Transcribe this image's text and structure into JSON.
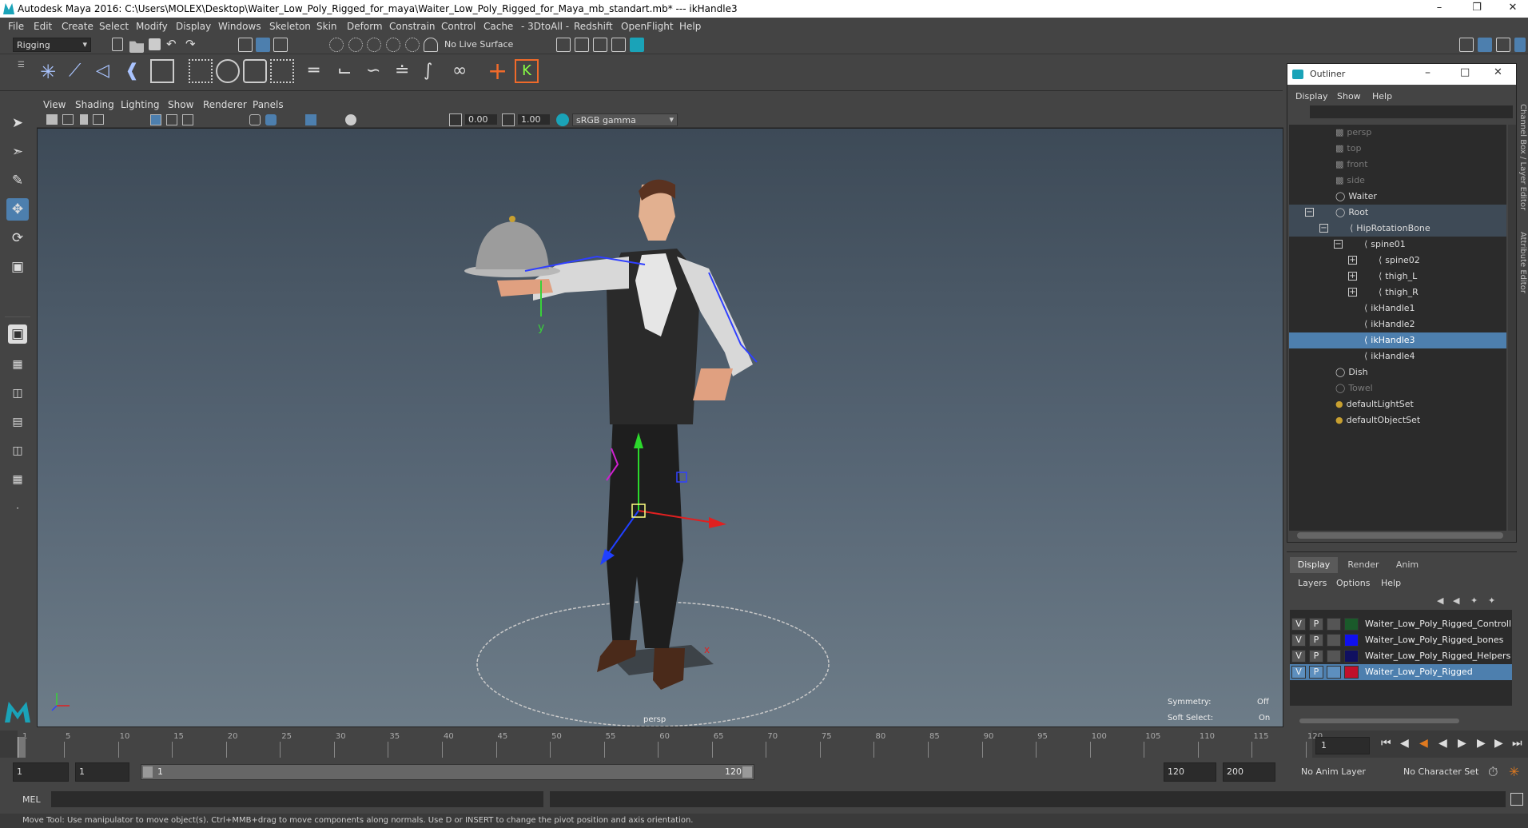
{
  "window": {
    "title": "Autodesk Maya 2016: C:\\Users\\MOLEX\\Desktop\\Waiter_Low_Poly_Rigged_for_maya\\Waiter_Low_Poly_Rigged_for_Maya_mb_standart.mb*   ---   ikHandle3"
  },
  "menus": [
    "File",
    "Edit",
    "Create",
    "Select",
    "Modify",
    "Display",
    "Windows",
    "Skeleton",
    "Skin",
    "Deform",
    "Constrain",
    "Control",
    "Cache",
    "- 3DtoAll -",
    "Redshift",
    "OpenFlight",
    "Help"
  ],
  "status": {
    "mode": "Rigging",
    "live_surface": "No Live Surface"
  },
  "viewport": {
    "menus": [
      "View",
      "Shading",
      "Lighting",
      "Show",
      "Renderer",
      "Panels"
    ],
    "exposure": "0.00",
    "gamma": "1.00",
    "color_space": "sRGB gamma",
    "camera_label": "persp",
    "symmetry_label": "Symmetry:",
    "symmetry_value": "Off",
    "soft_select_label": "Soft Select:",
    "soft_select_value": "On",
    "axis_y": "y",
    "axis_x": "x"
  },
  "outliner": {
    "title": "Outliner",
    "menus": [
      "Display",
      "Show",
      "Help"
    ],
    "items": [
      "persp",
      "top",
      "front",
      "side",
      "Waiter",
      "Root",
      "HipRotationBone",
      "spine01",
      "spine02",
      "thigh_L",
      "thigh_R",
      "ikHandle1",
      "ikHandle2",
      "ikHandle3",
      "ikHandle4",
      "Dish",
      "Towel",
      "defaultLightSet",
      "defaultObjectSet"
    ],
    "selected": "ikHandle3"
  },
  "layer_editor": {
    "tabs": [
      "Display",
      "Render",
      "Anim"
    ],
    "menus": [
      "Layers",
      "Options",
      "Help"
    ],
    "v": "V",
    "p": "P",
    "layers": [
      {
        "name": "Waiter_Low_Poly_Rigged_Controllers",
        "color": "#1a5a2a"
      },
      {
        "name": "Waiter_Low_Poly_Rigged_bones",
        "color": "#1010ee"
      },
      {
        "name": "Waiter_Low_Poly_Rigged_Helpers",
        "color": "#101060"
      },
      {
        "name": "Waiter_Low_Poly_Rigged",
        "color": "#c0102a"
      }
    ]
  },
  "timeline": {
    "ticks": [
      "1",
      "5",
      "10",
      "15",
      "20",
      "25",
      "30",
      "35",
      "40",
      "45",
      "50",
      "55",
      "60",
      "65",
      "70",
      "75",
      "80",
      "85",
      "90",
      "95",
      "100",
      "105",
      "110",
      "115",
      "120"
    ],
    "current_frame": "1",
    "range_start": "1",
    "range_start2": "1",
    "range_slider_start": "1",
    "range_slider_end": "120",
    "range_end": "120",
    "anim_end": "200",
    "anim_layer": "No Anim Layer",
    "character_set": "No Character Set"
  },
  "command": {
    "label": "MEL",
    "help": "Move Tool: Use manipulator to move object(s). Ctrl+MMB+drag to move components along normals. Use D or INSERT to change the pivot position and axis orientation."
  },
  "side_tabs": [
    "Channel Box / Layer Editor",
    "Attribute Editor"
  ],
  "colors": {
    "selection": "#4d7fae",
    "panel": "#444444",
    "viewport_top": "#3d4a57",
    "viewport_bottom": "#6d7c88"
  }
}
